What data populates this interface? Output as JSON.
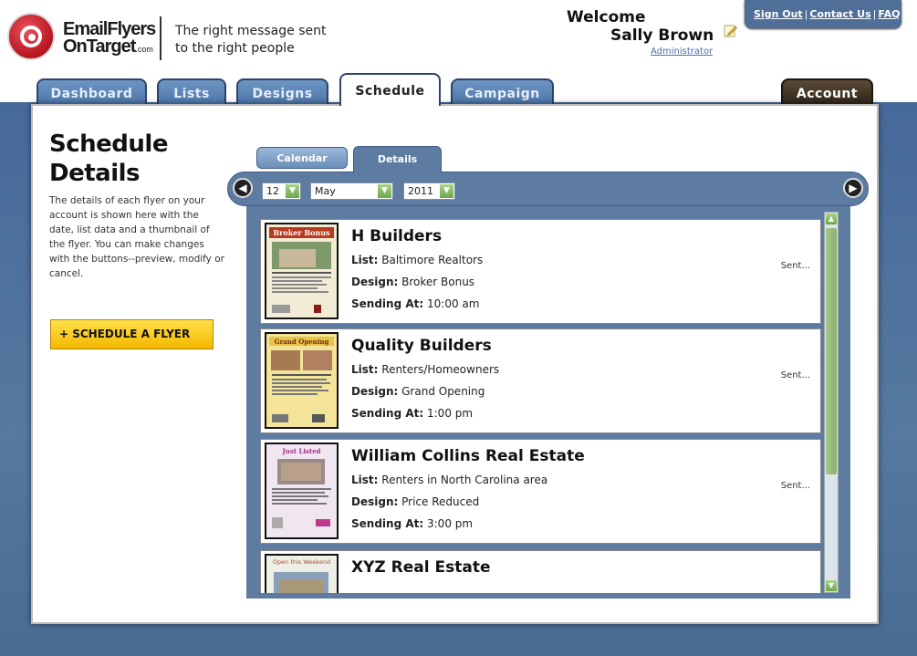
{
  "brand": {
    "logo_line1": "EmailFlyers",
    "logo_line2": "OnTarget",
    "logo_suffix": ".com",
    "tagline_line1": "The right message sent",
    "tagline_line2": "to the right people"
  },
  "user": {
    "welcome": "Welcome",
    "name": "Sally Brown",
    "role": "Administrator"
  },
  "top_links": {
    "sign_out": "Sign Out",
    "contact": "Contact Us",
    "faq": "FAQ",
    "separator": "|"
  },
  "tabs": [
    {
      "label": "Dashboard"
    },
    {
      "label": "Lists"
    },
    {
      "label": "Designs"
    },
    {
      "label": "Schedule"
    },
    {
      "label": "Campaign"
    },
    {
      "label": "Account"
    }
  ],
  "page": {
    "title_line1": "Schedule",
    "title_line2": "Details",
    "description": "The details of each flyer on your account is shown here with the date, list data and a thumbnail of the flyer. You can make changes with the buttons--preview, modify or cancel.",
    "schedule_button": "+ SCHEDULE A FLYER"
  },
  "subtabs": {
    "calendar": "Calendar",
    "details": "Details"
  },
  "date": {
    "day": "12",
    "month": "May",
    "year": "2011"
  },
  "labels": {
    "list": "List:",
    "design": "Design:",
    "sending": "Sending At:"
  },
  "flyers": [
    {
      "company": "H Builders",
      "list": "Baltimore Realtors",
      "design": "Broker Bonus",
      "time": "10:00 am",
      "status": "Sent...",
      "thumb_title": "Broker Bonus"
    },
    {
      "company": "Quality Builders",
      "list": "Renters/Homeowners",
      "design": "Grand Opening",
      "time": "1:00 pm",
      "status": "Sent...",
      "thumb_title": "Grand Opening"
    },
    {
      "company": "William Collins Real Estate",
      "list": "Renters in North Carolina area",
      "design": "Price Reduced",
      "time": "3:00 pm",
      "status": "Sent...",
      "thumb_title": "Just Listed"
    },
    {
      "company": "XYZ Real Estate",
      "thumb_title": "Open this Weekend"
    }
  ],
  "colors": {
    "accent_blue": "#5e7ca1",
    "tab_blue": "#4a72a6",
    "button_yellow": "#f4b800",
    "scroll_green": "#8ab06c"
  }
}
